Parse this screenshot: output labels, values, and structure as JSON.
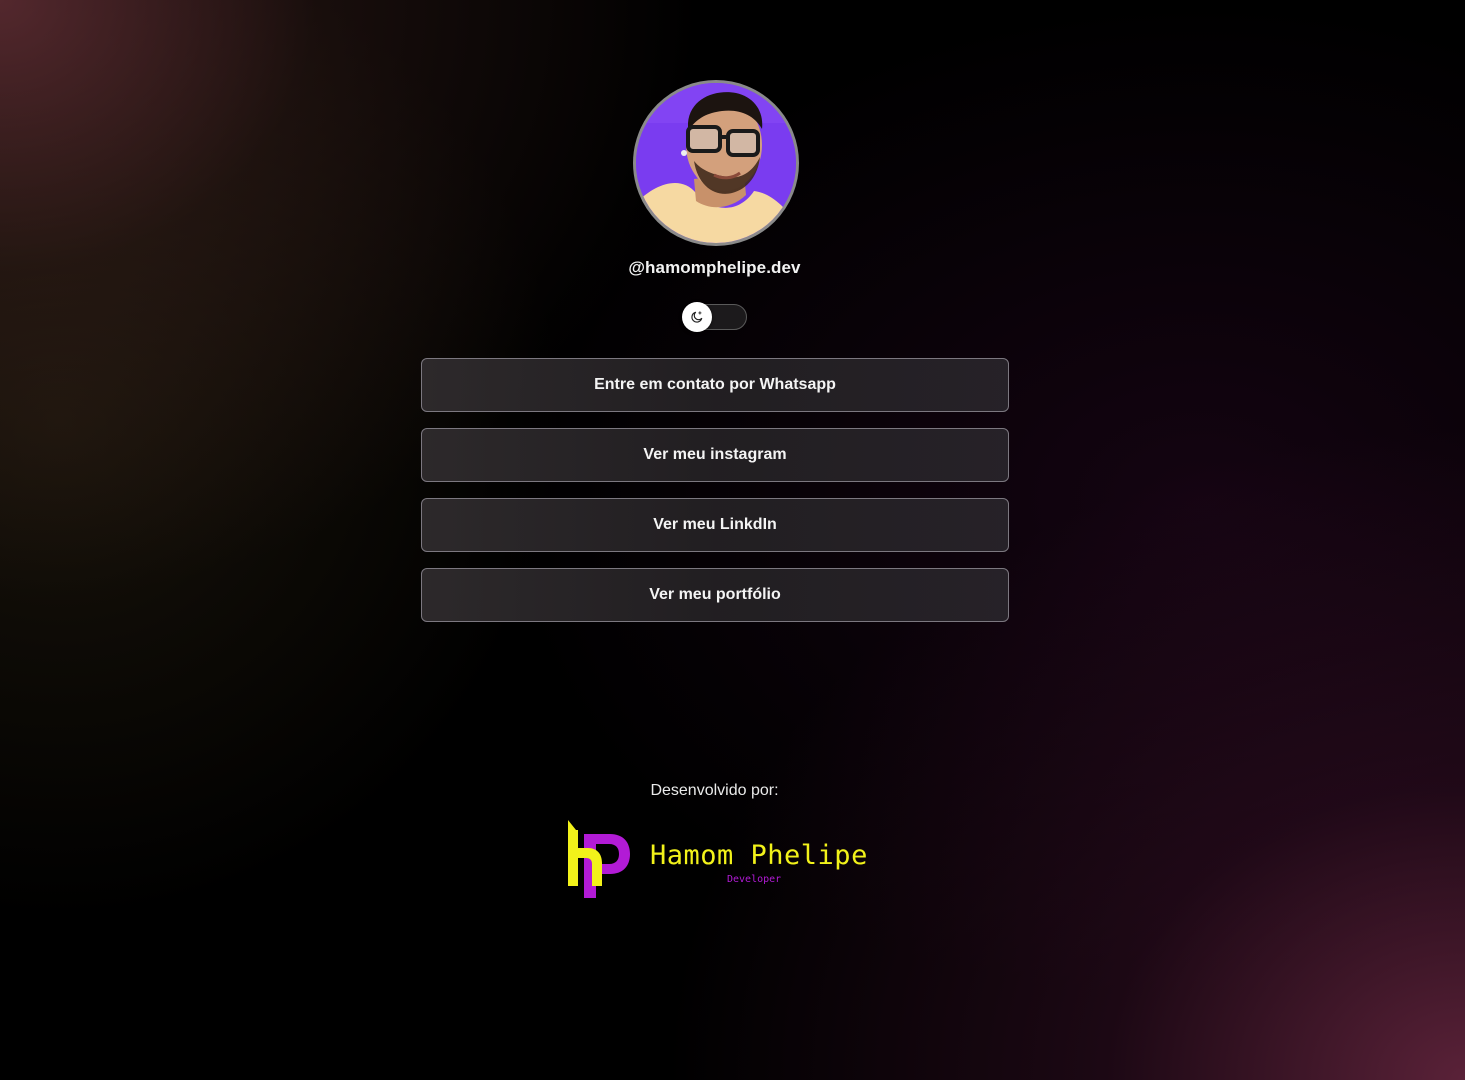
{
  "profile": {
    "handle": "@hamomphelipe.dev",
    "avatar_alt": "Foto de perfil"
  },
  "theme_toggle": {
    "icon": "moon-icon",
    "state": "dark"
  },
  "links": [
    {
      "label": "Entre em contato por Whatsapp"
    },
    {
      "label": "Ver meu instagram"
    },
    {
      "label": "Ver meu LinkdIn"
    },
    {
      "label": "Ver meu portfólio"
    }
  ],
  "footer": {
    "credits_label": "Desenvolvido por:",
    "brand_name": "Hamom Phelipe",
    "brand_sub": "Developer"
  },
  "colors": {
    "brand_yellow": "#f2f21a",
    "brand_purple": "#b21bd6",
    "avatar_bg": "#7a3cf0"
  }
}
